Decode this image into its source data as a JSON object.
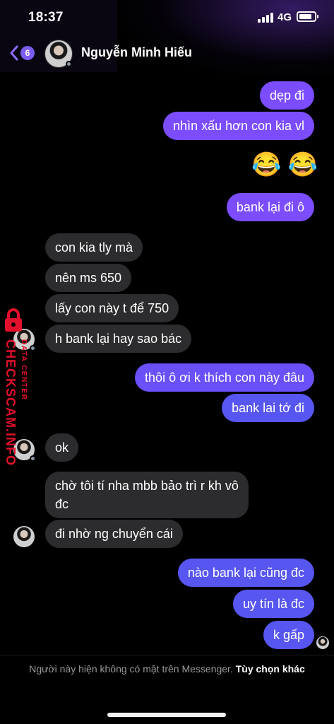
{
  "status_bar": {
    "time": "18:37",
    "network": "4G"
  },
  "header": {
    "back_count": "6",
    "contact_name": "Nguyễn Minh Hiếu"
  },
  "messages": [
    {
      "dir": "out",
      "text": "dẹp đi"
    },
    {
      "dir": "out",
      "text": "nhìn xấu hơn con kia vl"
    },
    {
      "dir": "out",
      "emoji": "😂 😂"
    },
    {
      "dir": "out",
      "text": "bank lại đi ô"
    },
    {
      "dir": "in",
      "text": "con kia tly mà"
    },
    {
      "dir": "in",
      "text": "nên ms 650"
    },
    {
      "dir": "in",
      "text": "lấy con này t để 750"
    },
    {
      "dir": "in",
      "text": "h bank lại hay sao bác"
    },
    {
      "dir": "out",
      "text": "thôi ô ơi k thích con này đâu"
    },
    {
      "dir": "out",
      "text": "bank lai tớ đi"
    },
    {
      "dir": "in",
      "text": "ok"
    },
    {
      "dir": "in",
      "text": "chờ tôi tí nha mbb bảo trì r kh vô đc"
    },
    {
      "dir": "in",
      "text": "đi nhờ ng chuyển cái"
    },
    {
      "dir": "out",
      "text": "nào bank lại cũng đc"
    },
    {
      "dir": "out",
      "text": "uy tín là đc"
    },
    {
      "dir": "out",
      "text": "k gấp"
    }
  ],
  "watermark": {
    "main": "CHECKSCAM.INFO",
    "sub": "DATA CENTER"
  },
  "footer": {
    "notice": "Người này hiện không có mặt trên Messenger.",
    "action": "Tùy chọn khác"
  },
  "colors": {
    "sent_purple": "#7c4dff",
    "sent_blue": "#5856f0",
    "received": "#2c2c2e",
    "badge": "#7a5cf0",
    "watermark": "#e2102a"
  }
}
